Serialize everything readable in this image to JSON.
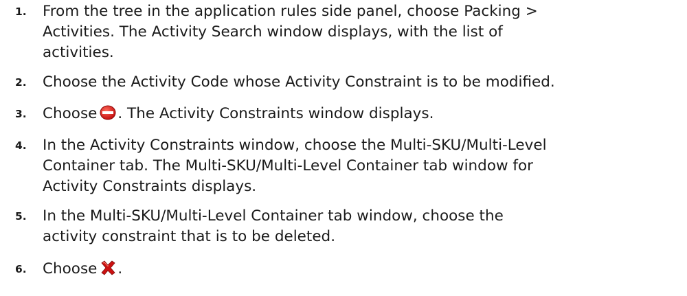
{
  "steps": [
    {
      "number": "1.",
      "lines": [
        "From the tree in the application rules side panel, choose Packing >",
        "Activities. The Activity Search window displays, with the list of",
        "activities."
      ]
    },
    {
      "number": "2.",
      "lines": [
        "Choose the Activity Code whose Activity Constraint is to be modified."
      ]
    },
    {
      "number": "3.",
      "before_icon": "Choose",
      "icon": "delete-record-icon",
      "icon_color": "#cc1111",
      "after_icon": ". The Activity Constraints window displays."
    },
    {
      "number": "4.",
      "lines": [
        "In the Activity Constraints window, choose the Multi-SKU/Multi-Level",
        "Container tab. The Multi-SKU/Multi-Level Container tab window for",
        "Activity Constraints displays."
      ]
    },
    {
      "number": "5.",
      "lines": [
        "In the Multi-SKU/Multi-Level Container tab window, choose the",
        "activity constraint that is to be deleted."
      ]
    },
    {
      "number": "6.",
      "before_icon": "Choose",
      "icon": "delete-x-icon",
      "icon_color": "#cc1111",
      "after_icon": "."
    }
  ]
}
